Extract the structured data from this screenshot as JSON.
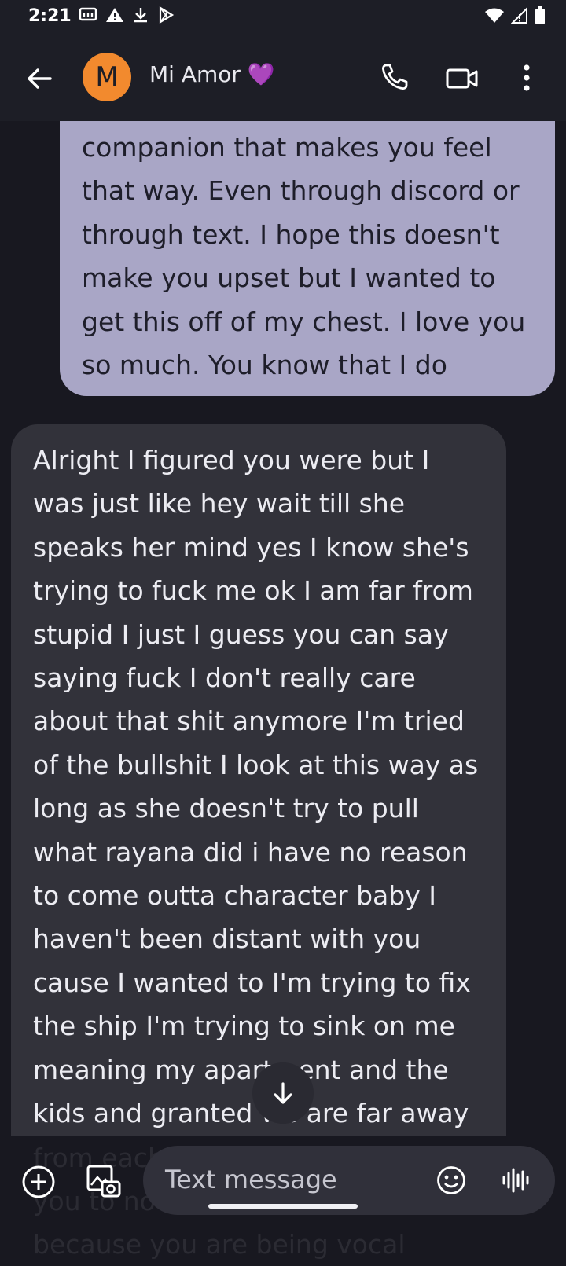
{
  "status_bar": {
    "time": "2:21",
    "left_icons": [
      "messaging-icon",
      "alert-icon",
      "download-icon",
      "play-store-icon"
    ],
    "right_icons": [
      "wifi-icon",
      "signal-icon",
      "battery-icon"
    ]
  },
  "header": {
    "avatar_letter": "M",
    "avatar_color": "#f28a2e",
    "contact_name": "Mi Amor",
    "contact_emoji": "💜"
  },
  "messages": [
    {
      "direction": "outgoing",
      "text": "companion that makes you feel\nthat way. Even through discord or\nthrough text. I hope this doesn't\nmake you upset but I wanted to\nget this off of my chest. I love you\nso much. You know that I do"
    },
    {
      "direction": "incoming",
      "text": "Alright I figured you were but I\nwas just like hey wait till she\nspeaks her mind yes I know she's\ntrying to fuck me ok I am far from\nstupid I just I guess you can say\nsaying fuck I don't really care\nabout that shit anymore I'm tried\nof the bullshit  I look at this way as\nlong as she doesn't try to pull\nwhat rayana did i have no reason\nto come outta character baby I\nhaven't been distant with you\ncause I wanted to I'm trying to fix\nthe ship I'm trying to sink on me\nmeaning my apartment and the\nkids and granted we are far away"
    }
  ],
  "bleed_text": "from each\nyou to not\nbecause you are being vocal",
  "compose": {
    "placeholder": "Text message"
  },
  "colors": {
    "outgoing_bubble": "#a9a6c6",
    "incoming_bubble": "#32323a",
    "background": "#181820"
  }
}
